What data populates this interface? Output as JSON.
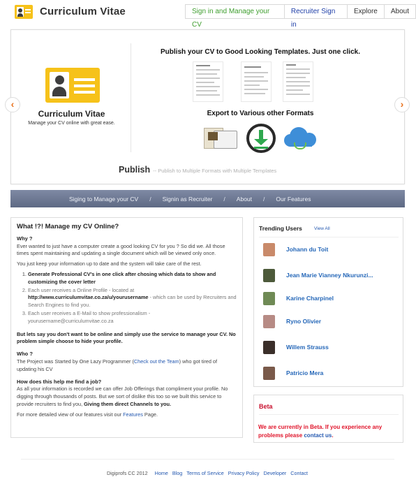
{
  "header": {
    "brand": "Curriculum Vitae",
    "nav": [
      "Sign in and Manage your CV",
      "Recruiter Sign in",
      "Explore",
      "About"
    ]
  },
  "slider": {
    "logo_title": "Curriculum Vitae",
    "logo_subtitle": "Manage your CV online with great ease.",
    "publish_heading": "Publish your CV to Good Looking Templates. Just one click.",
    "export_heading": "Export to Various  other Formats",
    "caption_title": "Publish",
    "caption_text": "-- Publish to Multiple Formats with Multiple Templates",
    "prev_arrow": "‹",
    "next_arrow": "›"
  },
  "navband": {
    "items": [
      "Siging to Manage your CV",
      "Signin as Recruiter",
      "About",
      "Our Features"
    ],
    "separator": "/"
  },
  "main": {
    "title": "What !?! Manage my CV Online?",
    "why_heading": "Why ?",
    "why_p1": "Ever wanted to just have a computer create a good looking CV for you ? So did we. All those times spent maintaining and updating a single document which will be viewed only once.",
    "why_p2": "You just keep your information up to date and the system will take care of the rest.",
    "list": {
      "item1": "Generate Professional CV's in one click after chosing which data to show and customizing the cover letter",
      "item2_pre": "Each user receives a Online Profile - located at ",
      "item2_url": "http://www.curriculumvitae.co.za/u/yourusername",
      "item2_post": " - which can be used by Recruiters and Search Engines to find you.",
      "item3": "Each user receives a E-Mail to show professionalism - yourusername@curriculumvitae.co.za"
    },
    "offline_text": "But lets say you don't want to be online and simply use the service to manage your CV. No problem simple choose to hide your profile.",
    "who_heading": "Who ?",
    "who_pre": "The Project was Started by One Lazy Programmer (",
    "who_link": "Check out the Team",
    "who_post": ") who got tired of updating his CV",
    "how_heading": "How does this help me find a job?",
    "how_text": "As all your information is recorded we can offer Job Offerings that compliment your profile. No digging through thousands of posts. But we sort of dislike this too so we built this service to provide recruiters to find you, ",
    "how_bold": "Giving them direct Channels to you.",
    "more_pre": "For more detailed view of our features visit our ",
    "more_link": "Features",
    "more_post": " Page."
  },
  "trending": {
    "title": "Trending Users",
    "view_all": "View All",
    "users": [
      {
        "name": "Johann du Toit",
        "color": "#c98a6a"
      },
      {
        "name": "Jean Marie Vianney Nkurunzi...",
        "color": "#4d5a3a"
      },
      {
        "name": "Karine Charpinel",
        "color": "#6f8a55"
      },
      {
        "name": "Ryno Olivier",
        "color": "#b78b85"
      },
      {
        "name": "Willem Strauss",
        "color": "#3b2f2a"
      },
      {
        "name": "Patricio Mera",
        "color": "#7a5a4a"
      }
    ]
  },
  "beta": {
    "title": "Beta",
    "text": "We are currently in Beta. If you experience any problems please ",
    "link": "contact us",
    "end": "."
  },
  "footer": {
    "copyright": "Digiprofs CC 2012",
    "links": [
      "Home",
      "Blog",
      "Terms of Service",
      "Privacy Policy",
      "Developer",
      "Contact"
    ]
  }
}
